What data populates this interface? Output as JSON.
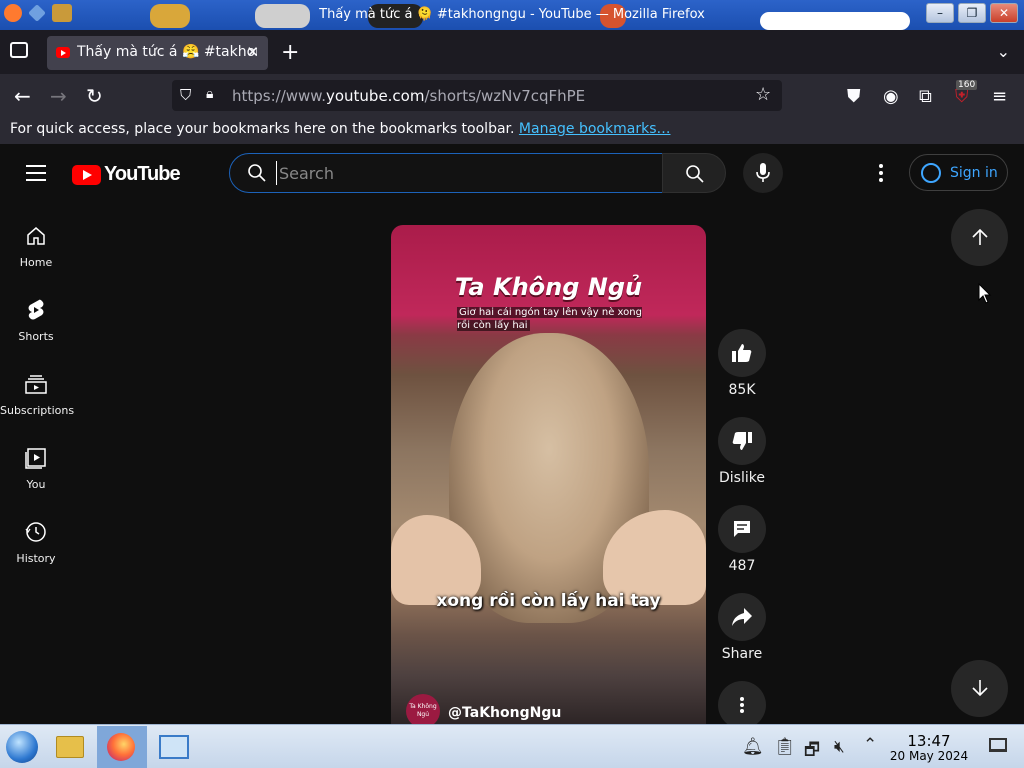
{
  "window": {
    "title": "Thấy mà tức á 🫠 #takhongngu - YouTube — Mozilla Firefox"
  },
  "browser": {
    "tab_title": "Thấy mà tức á 😤 #takhongngu",
    "tab_close": "✕",
    "new_tab": "+",
    "url_prefix": "https://www.",
    "url_domain": "youtube.com",
    "url_path": "/shorts/wzNv7cqFhPE",
    "extension_badge": "160",
    "bookmarks_message": "For quick access, place your bookmarks here on the bookmarks toolbar.",
    "bookmarks_link": "Manage bookmarks…"
  },
  "youtube": {
    "logo_text": "YouTube",
    "search_placeholder": "Search",
    "sign_in": "Sign in",
    "sidebar": [
      {
        "label": "Home"
      },
      {
        "label": "Shorts"
      },
      {
        "label": "Subscriptions"
      },
      {
        "label": "You"
      },
      {
        "label": "History"
      }
    ],
    "video": {
      "brand_title": "Ta Không Ngủ",
      "top_subtitle": "Giơ hai cái ngón tay lên vậy nè xong rồi còn lấy hai",
      "caption": "xong rồi còn lấy hai tay",
      "channel": "@TaKhongNgu",
      "channel_avatar_text": "Ta Không Ngủ"
    },
    "actions": {
      "likes": "85K",
      "dislike": "Dislike",
      "comments": "487",
      "share": "Share"
    }
  },
  "taskbar": {
    "time": "13:47",
    "date": "20 May 2024"
  },
  "colors": {
    "accent_blue": "#3ea6ff",
    "youtube_red": "#ff0000",
    "firefox_link": "#45c1ff"
  }
}
